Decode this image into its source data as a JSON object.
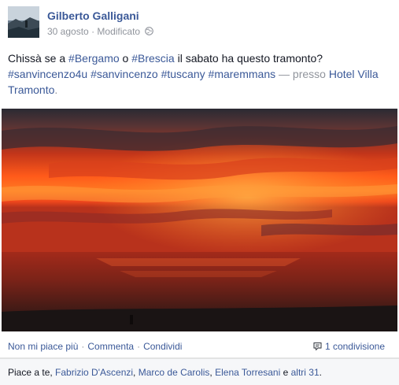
{
  "post": {
    "author": "Gilberto Galligani",
    "date": "30 agosto",
    "dot": "·",
    "edited": "Modificato",
    "privacy_icon": "globe-icon"
  },
  "text": {
    "pre1": "Chissà se a ",
    "tag_bergamo": "#Bergamo",
    "mid1": " o ",
    "tag_brescia": "#Brescia",
    "post1": " il sabato ha questo tramonto?",
    "tag_sanvincenzo4u": "#sanvincenzo4u",
    "tag_sanvincenzo": "#sanvincenzo",
    "tag_tuscany": "#tuscany",
    "tag_maremmans": "#maremmans",
    "presso": "— presso",
    "place": "Hotel Villa Tramonto",
    "period": "."
  },
  "actions": {
    "unlike": "Non mi piace più",
    "comment": "Commenta",
    "share": "Condividi",
    "dot": "·",
    "shares_count": "1 condivisione"
  },
  "likes": {
    "prefix": "Piace a te, ",
    "names": [
      "Fabrizio D'Ascenzi",
      "Marco de Carolis",
      "Elena Torresani"
    ],
    "comma": ", ",
    "and_others": "altri 31",
    "and": " e ",
    "suffix": "."
  },
  "colors": {
    "link": "#3b5998",
    "meta": "#90949c",
    "text": "#141823"
  }
}
